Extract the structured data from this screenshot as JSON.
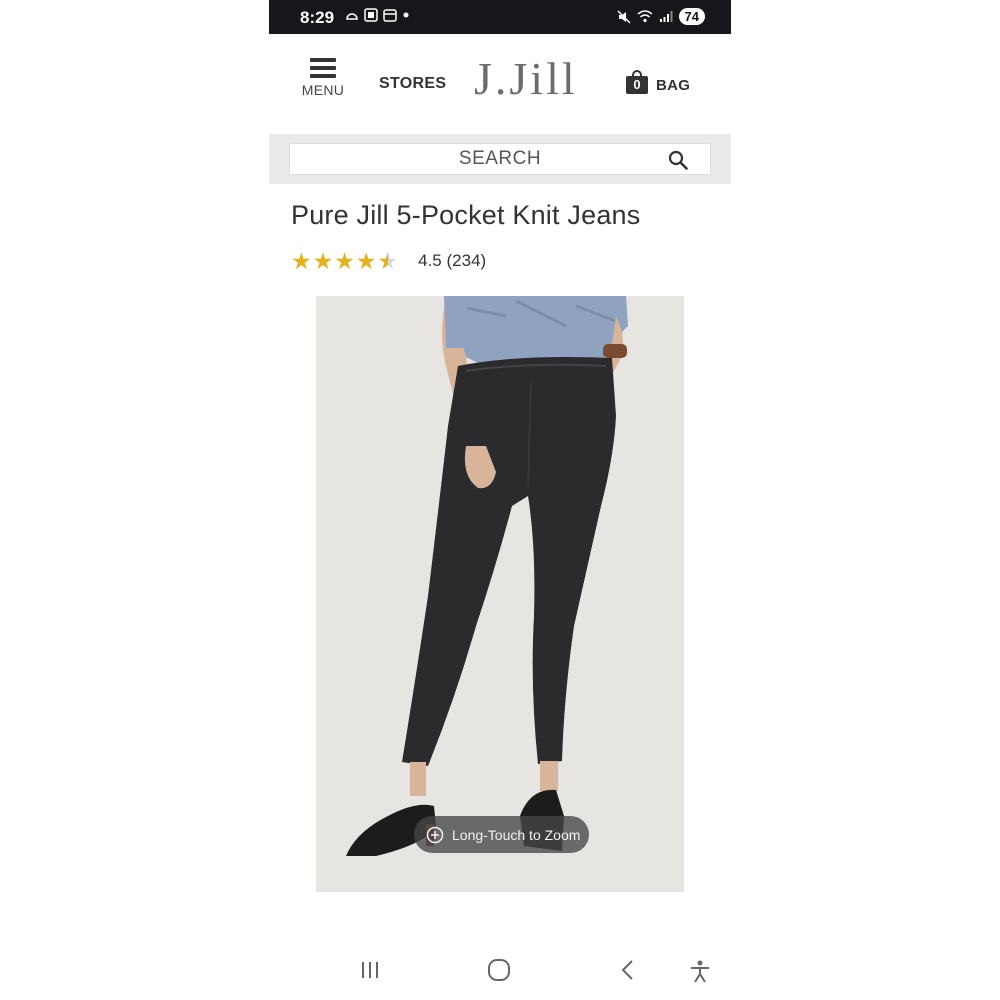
{
  "status_bar": {
    "time": "8:29",
    "battery": "74"
  },
  "header": {
    "menu_label": "MENU",
    "stores_label": "STORES",
    "logo_text": "J.Jill",
    "bag_count": "0",
    "bag_label": "BAG"
  },
  "search": {
    "placeholder": "SEARCH"
  },
  "product": {
    "title": "Pure Jill 5-Pocket Knit Jeans",
    "rating_value": "4.5",
    "rating_count": "(234)",
    "rating_stars": 4.5,
    "image_alt": "Model wearing black knit jeans with blue floral blouse and black slide sandals",
    "zoom_hint": "Long-Touch to Zoom"
  },
  "colors": {
    "star": "#e3b21c",
    "status_bar_bg": "#16161b",
    "search_bar_bg": "#eaeaea",
    "text": "#333333"
  },
  "icons": {
    "menu": "hamburger-icon",
    "bag": "shopping-bag-icon",
    "search": "magnifier-icon",
    "zoom": "plus-circle-icon",
    "nav_recent": "recent-apps-icon",
    "nav_home": "home-icon",
    "nav_back": "back-icon",
    "nav_accessibility": "accessibility-icon"
  }
}
